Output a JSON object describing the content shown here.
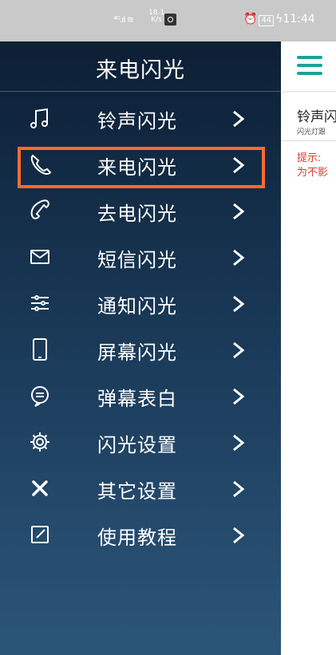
{
  "status_bar": {
    "signal": "⁴ᴳ.░",
    "speed_value": "18.1",
    "speed_unit": "K/s",
    "battery": "44",
    "time": "11:44"
  },
  "drawer": {
    "title": "来电闪光",
    "items": [
      {
        "label": "铃声闪光",
        "icon": "music-note-icon"
      },
      {
        "label": "来电闪光",
        "icon": "phone-icon"
      },
      {
        "label": "去电闪光",
        "icon": "outgoing-phone-icon"
      },
      {
        "label": "短信闪光",
        "icon": "envelope-icon"
      },
      {
        "label": "通知闪光",
        "icon": "sliders-icon"
      },
      {
        "label": "屏幕闪光",
        "icon": "smartphone-icon"
      },
      {
        "label": "弹幕表白",
        "icon": "chat-bubble-icon"
      },
      {
        "label": "闪光设置",
        "icon": "gear-icon"
      },
      {
        "label": "其它设置",
        "icon": "tools-icon"
      },
      {
        "label": "使用教程",
        "icon": "edit-icon"
      }
    ],
    "selected_index": 1
  },
  "content": {
    "title": "铃声闪",
    "subtitle": "闪光灯跟",
    "tip_line1": "提示:",
    "tip_line2": "为不影"
  },
  "colors": {
    "accent": "#1aa39a",
    "highlight": "#ff6a2c",
    "tip": "#e53935"
  }
}
